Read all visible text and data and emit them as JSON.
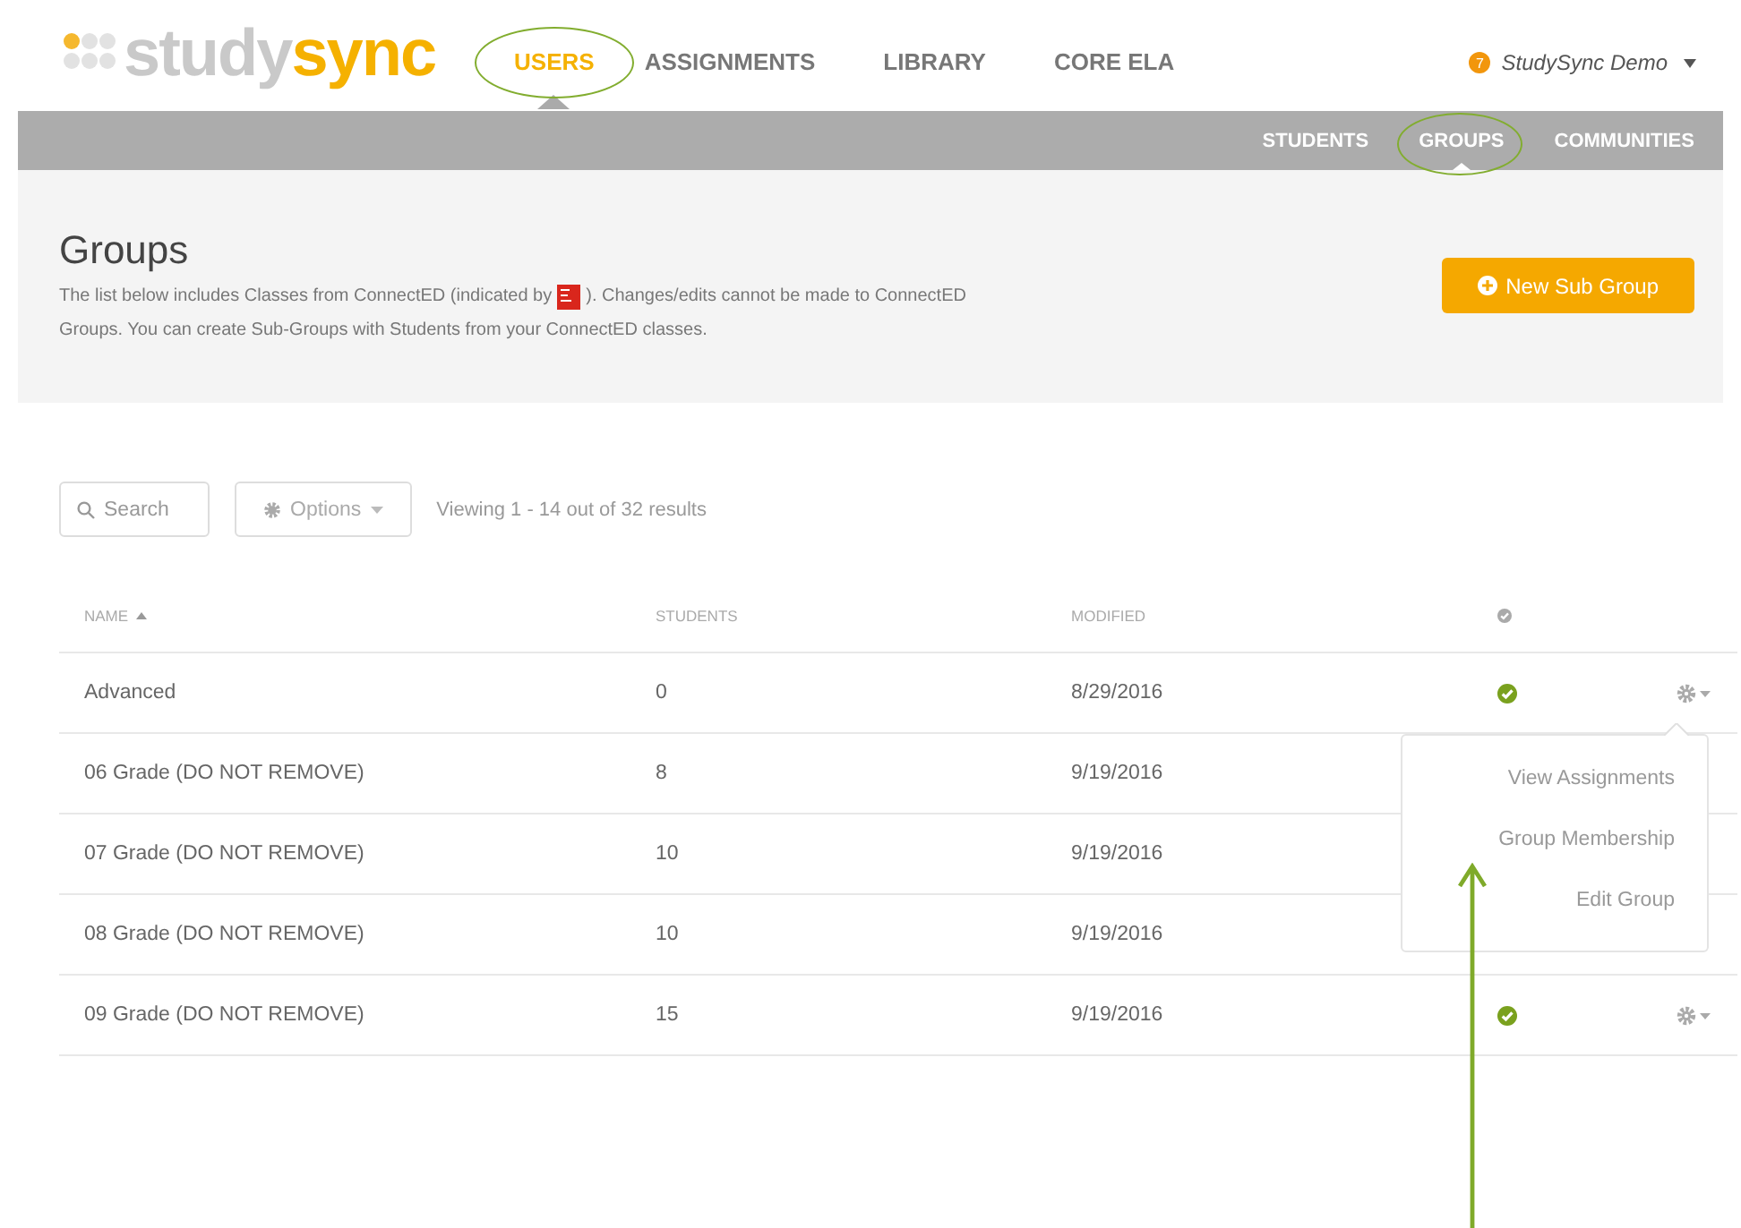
{
  "logo": {
    "part_1": "study",
    "part_2": "sync"
  },
  "nav": [
    {
      "label": "USERS",
      "selected": true,
      "circled": true
    },
    {
      "label": "ASSIGNMENTS",
      "selected": false,
      "circled": false
    },
    {
      "label": "LIBRARY",
      "selected": false,
      "circled": false
    },
    {
      "label": "CORE ELA",
      "selected": false,
      "circled": false
    }
  ],
  "user_menu": {
    "badge": "7",
    "name": "StudySync Demo"
  },
  "subnav": [
    {
      "label": "STUDENTS",
      "selected": false,
      "circled": false
    },
    {
      "label": "GROUPS",
      "selected": true,
      "circled": true
    },
    {
      "label": "COMMUNITIES",
      "selected": false,
      "circled": false
    }
  ],
  "page_header": {
    "title": "Groups",
    "description_line_1_before": "The list below includes Classes from ConnectED (indicated by",
    "description_line_1_after": "). Changes/edits cannot be made to ConnectED",
    "description_line_2": "Groups. You can create Sub-Groups with Students from your ConnectED classes.",
    "button": "New Sub Group"
  },
  "toolbar": {
    "search_placeholder": "Search",
    "options": "Options",
    "viewing": "Viewing 1 - 14 out of 32 results"
  },
  "table": {
    "columns": [
      "NAME",
      "STUDENTS",
      "MODIFIED"
    ],
    "rows": [
      {
        "name": "Advanced",
        "students": "0",
        "modified": "8/29/2016",
        "verified": true,
        "actions": true
      },
      {
        "name": "06 Grade (DO NOT REMOVE)",
        "students": "8",
        "modified": "9/19/2016",
        "verified": false,
        "actions": false
      },
      {
        "name": "07 Grade (DO NOT REMOVE)",
        "students": "10",
        "modified": "9/19/2016",
        "verified": false,
        "actions": false
      },
      {
        "name": "08 Grade (DO NOT REMOVE)",
        "students": "10",
        "modified": "9/19/2016",
        "verified": false,
        "actions": false
      },
      {
        "name": "09 Grade (DO NOT REMOVE)",
        "students": "15",
        "modified": "9/19/2016",
        "verified": true,
        "actions": true
      }
    ]
  },
  "dropdown": {
    "items": [
      "View Assignments",
      "Group Membership",
      "Edit Group"
    ]
  },
  "annotation": {
    "arrow": true
  }
}
